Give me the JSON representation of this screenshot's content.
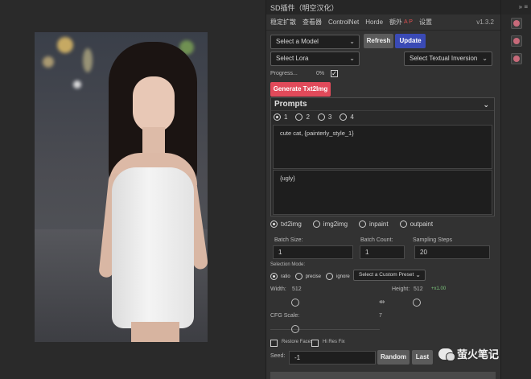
{
  "window": {
    "title": "SD插件（明空汉化）",
    "controls": "»  ≡"
  },
  "tabs": [
    {
      "label": "稳定扩散"
    },
    {
      "label": "查看器"
    },
    {
      "label": "ControlNet"
    },
    {
      "label": "Horde"
    },
    {
      "label": "额外"
    },
    {
      "label": "设置"
    }
  ],
  "tab_badge": "A P",
  "version": "v1.3.2",
  "model": {
    "select_model": "Select a Model",
    "refresh_label": "Refresh",
    "update_label": "Update",
    "select_lora": "Select Lora",
    "select_textual_inversion": "Select Textual Inversion"
  },
  "progress": {
    "label": "Progress...",
    "value": "0%"
  },
  "generate_label": "Generate Txt2Img",
  "prompts": {
    "title": "Prompts",
    "slots": [
      "1",
      "2",
      "3",
      "4"
    ],
    "positive": "cute cat, {painterly_style_1}",
    "negative": "{ugly}"
  },
  "modes": [
    "txt2img",
    "img2img",
    "inpaint",
    "outpaint"
  ],
  "batch_size": {
    "label": "Batch Size:",
    "value": "1"
  },
  "batch_count": {
    "label": "Batch Count:",
    "value": "1"
  },
  "sampling_steps": {
    "label": "Sampling Steps",
    "value": "20"
  },
  "selection_mode": {
    "label": "Selection Mode:",
    "options": [
      "ratio",
      "precise",
      "ignore"
    ],
    "preset": "Select a Custom Preset"
  },
  "width": {
    "label": "Width:",
    "value": "512"
  },
  "height": {
    "label": "Height:",
    "value": "512",
    "extra": "+x1.00"
  },
  "cfg_scale": {
    "label": "CFG Scale:",
    "value": "7"
  },
  "restore_faces": "Restore Faces",
  "hi_res_fix": "Hi Res Fix",
  "seed": {
    "label": "Seed:",
    "value": "-1"
  },
  "random_label": "Random",
  "last_label": "Last",
  "watermark": "萤火笔记",
  "colors": {
    "accent_blue": "#3a4ab5",
    "accent_red": "#e14a5a",
    "panel_bg": "#323232"
  }
}
